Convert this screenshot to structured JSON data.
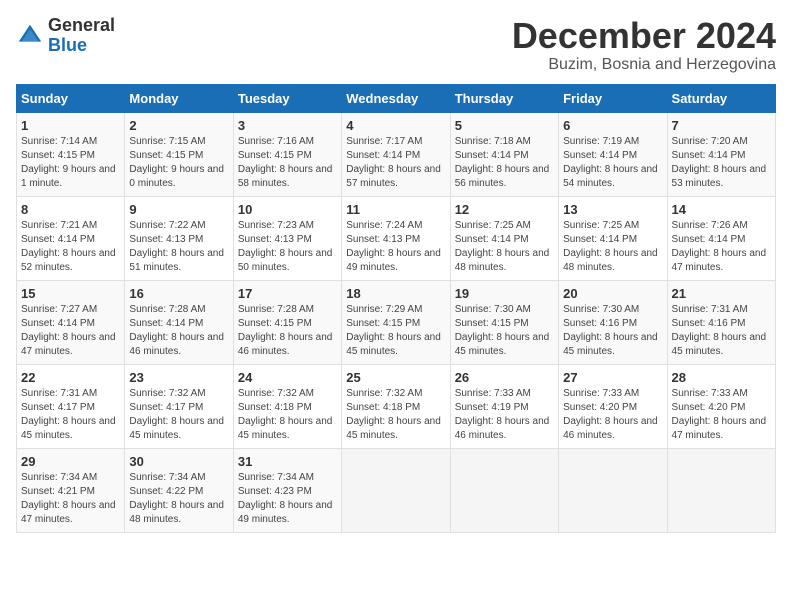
{
  "logo": {
    "general": "General",
    "blue": "Blue"
  },
  "title": "December 2024",
  "subtitle": "Buzim, Bosnia and Herzegovina",
  "days_of_week": [
    "Sunday",
    "Monday",
    "Tuesday",
    "Wednesday",
    "Thursday",
    "Friday",
    "Saturday"
  ],
  "weeks": [
    [
      {
        "day": "1",
        "sunrise": "7:14 AM",
        "sunset": "4:15 PM",
        "daylight": "9 hours and 1 minute."
      },
      {
        "day": "2",
        "sunrise": "7:15 AM",
        "sunset": "4:15 PM",
        "daylight": "9 hours and 0 minutes."
      },
      {
        "day": "3",
        "sunrise": "7:16 AM",
        "sunset": "4:15 PM",
        "daylight": "8 hours and 58 minutes."
      },
      {
        "day": "4",
        "sunrise": "7:17 AM",
        "sunset": "4:14 PM",
        "daylight": "8 hours and 57 minutes."
      },
      {
        "day": "5",
        "sunrise": "7:18 AM",
        "sunset": "4:14 PM",
        "daylight": "8 hours and 56 minutes."
      },
      {
        "day": "6",
        "sunrise": "7:19 AM",
        "sunset": "4:14 PM",
        "daylight": "8 hours and 54 minutes."
      },
      {
        "day": "7",
        "sunrise": "7:20 AM",
        "sunset": "4:14 PM",
        "daylight": "8 hours and 53 minutes."
      }
    ],
    [
      {
        "day": "8",
        "sunrise": "7:21 AM",
        "sunset": "4:14 PM",
        "daylight": "8 hours and 52 minutes."
      },
      {
        "day": "9",
        "sunrise": "7:22 AM",
        "sunset": "4:13 PM",
        "daylight": "8 hours and 51 minutes."
      },
      {
        "day": "10",
        "sunrise": "7:23 AM",
        "sunset": "4:13 PM",
        "daylight": "8 hours and 50 minutes."
      },
      {
        "day": "11",
        "sunrise": "7:24 AM",
        "sunset": "4:13 PM",
        "daylight": "8 hours and 49 minutes."
      },
      {
        "day": "12",
        "sunrise": "7:25 AM",
        "sunset": "4:14 PM",
        "daylight": "8 hours and 48 minutes."
      },
      {
        "day": "13",
        "sunrise": "7:25 AM",
        "sunset": "4:14 PM",
        "daylight": "8 hours and 48 minutes."
      },
      {
        "day": "14",
        "sunrise": "7:26 AM",
        "sunset": "4:14 PM",
        "daylight": "8 hours and 47 minutes."
      }
    ],
    [
      {
        "day": "15",
        "sunrise": "7:27 AM",
        "sunset": "4:14 PM",
        "daylight": "8 hours and 47 minutes."
      },
      {
        "day": "16",
        "sunrise": "7:28 AM",
        "sunset": "4:14 PM",
        "daylight": "8 hours and 46 minutes."
      },
      {
        "day": "17",
        "sunrise": "7:28 AM",
        "sunset": "4:15 PM",
        "daylight": "8 hours and 46 minutes."
      },
      {
        "day": "18",
        "sunrise": "7:29 AM",
        "sunset": "4:15 PM",
        "daylight": "8 hours and 45 minutes."
      },
      {
        "day": "19",
        "sunrise": "7:30 AM",
        "sunset": "4:15 PM",
        "daylight": "8 hours and 45 minutes."
      },
      {
        "day": "20",
        "sunrise": "7:30 AM",
        "sunset": "4:16 PM",
        "daylight": "8 hours and 45 minutes."
      },
      {
        "day": "21",
        "sunrise": "7:31 AM",
        "sunset": "4:16 PM",
        "daylight": "8 hours and 45 minutes."
      }
    ],
    [
      {
        "day": "22",
        "sunrise": "7:31 AM",
        "sunset": "4:17 PM",
        "daylight": "8 hours and 45 minutes."
      },
      {
        "day": "23",
        "sunrise": "7:32 AM",
        "sunset": "4:17 PM",
        "daylight": "8 hours and 45 minutes."
      },
      {
        "day": "24",
        "sunrise": "7:32 AM",
        "sunset": "4:18 PM",
        "daylight": "8 hours and 45 minutes."
      },
      {
        "day": "25",
        "sunrise": "7:32 AM",
        "sunset": "4:18 PM",
        "daylight": "8 hours and 45 minutes."
      },
      {
        "day": "26",
        "sunrise": "7:33 AM",
        "sunset": "4:19 PM",
        "daylight": "8 hours and 46 minutes."
      },
      {
        "day": "27",
        "sunrise": "7:33 AM",
        "sunset": "4:20 PM",
        "daylight": "8 hours and 46 minutes."
      },
      {
        "day": "28",
        "sunrise": "7:33 AM",
        "sunset": "4:20 PM",
        "daylight": "8 hours and 47 minutes."
      }
    ],
    [
      {
        "day": "29",
        "sunrise": "7:34 AM",
        "sunset": "4:21 PM",
        "daylight": "8 hours and 47 minutes."
      },
      {
        "day": "30",
        "sunrise": "7:34 AM",
        "sunset": "4:22 PM",
        "daylight": "8 hours and 48 minutes."
      },
      {
        "day": "31",
        "sunrise": "7:34 AM",
        "sunset": "4:23 PM",
        "daylight": "8 hours and 49 minutes."
      },
      null,
      null,
      null,
      null
    ]
  ]
}
